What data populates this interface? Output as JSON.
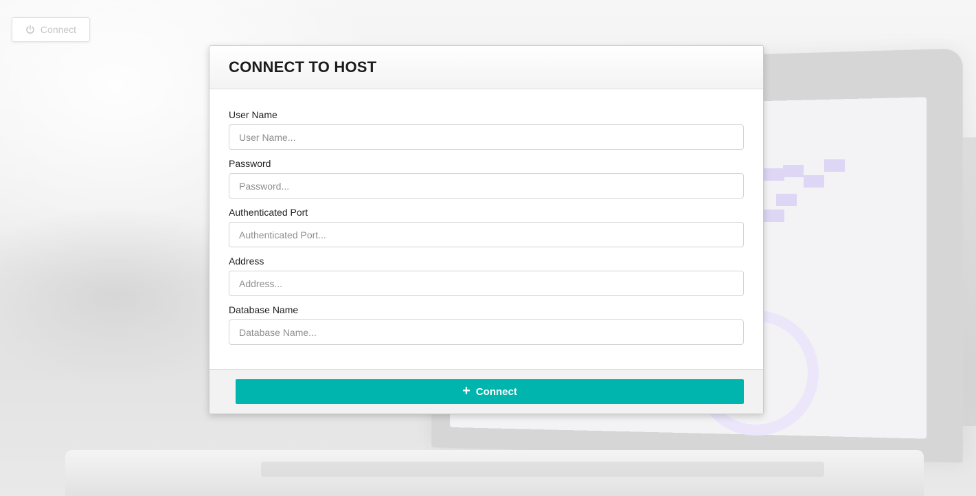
{
  "background": {
    "ghost_button": {
      "label": "Connect",
      "icon": "power-icon"
    }
  },
  "modal": {
    "title": "CONNECT TO HOST",
    "fields": [
      {
        "label": "User Name",
        "placeholder": "User Name...",
        "value": ""
      },
      {
        "label": "Password",
        "placeholder": "Password...",
        "value": ""
      },
      {
        "label": "Authenticated Port",
        "placeholder": "Authenticated Port...",
        "value": ""
      },
      {
        "label": "Address",
        "placeholder": "Address...",
        "value": ""
      },
      {
        "label": "Database Name",
        "placeholder": "Database Name...",
        "value": ""
      }
    ],
    "submit": {
      "label": "Connect",
      "icon": "plus-icon",
      "color": "#00b5ad"
    }
  }
}
